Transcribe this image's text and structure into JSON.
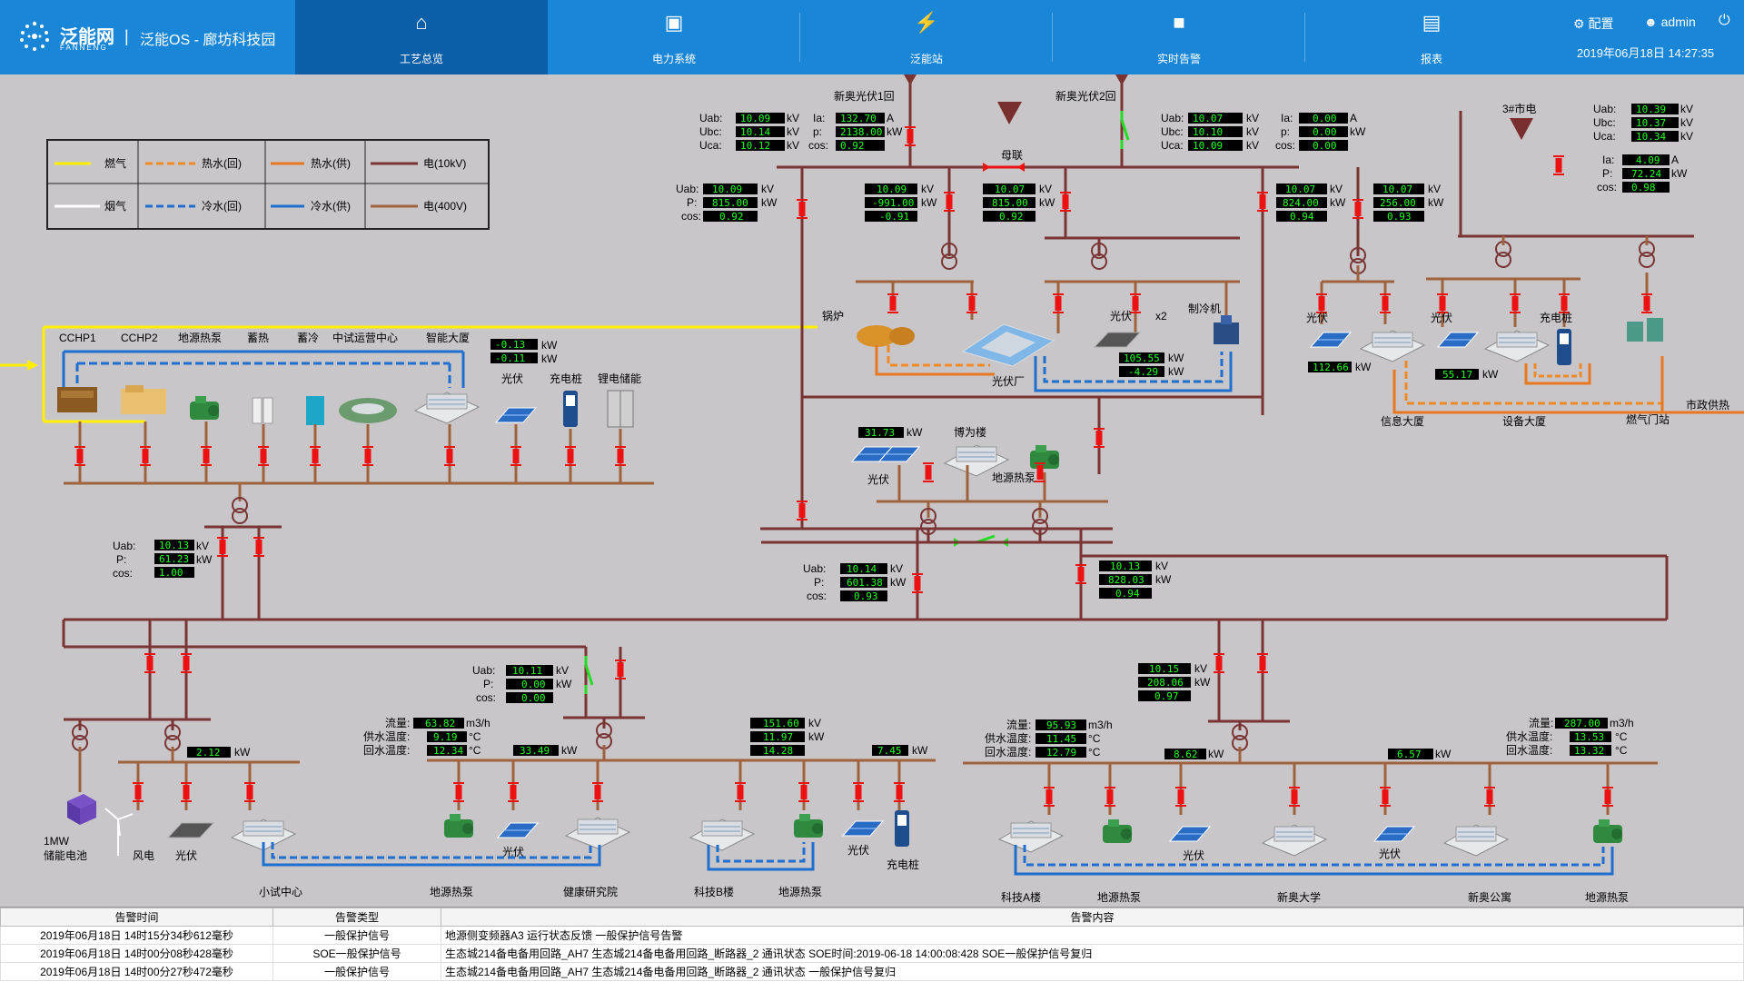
{
  "header": {
    "logo_cn": "泛能网",
    "logo_en": "FANNENG",
    "separator": "|",
    "system_title": "泛能OS - 廊坊科技园",
    "nav": [
      {
        "label": "工艺总览",
        "icon": "home-icon",
        "active": true
      },
      {
        "label": "电力系统",
        "icon": "monitor-icon",
        "active": false
      },
      {
        "label": "泛能站",
        "icon": "station-icon",
        "active": false
      },
      {
        "label": "实时告警",
        "icon": "alarm-icon",
        "active": false
      },
      {
        "label": "报表",
        "icon": "report-icon",
        "active": false
      }
    ],
    "config_label": "配置",
    "user_label": "admin",
    "datetime": "2019年06月18日 14:27:35"
  },
  "legend": {
    "items": [
      "燃气",
      "热水(回)",
      "热水(供)",
      "电(10kV)",
      "烟气",
      "冷水(回)",
      "冷水(供)",
      "电(400V)"
    ]
  },
  "labels": {
    "xinao_pv1": "新奥光伏1回",
    "xinao_pv2": "新奥光伏2回",
    "muliang": "母联",
    "city3": "3#市电",
    "boiler": "锅炉",
    "pv_plant": "光伏厂",
    "pv": "光伏",
    "x2": "x2",
    "chiller": "制冷机",
    "xinxi": "信息大厦",
    "shebei": "设备大厦",
    "charger": "充电桩",
    "shizheng": "市政供热",
    "ranqi_station": "燃气门站",
    "cchp1": "CCHP1",
    "cchp2": "CCHP2",
    "dyrb": "地源热泵",
    "xure": "蓄热",
    "xuleng": "蓄冷",
    "zszx": "中试运营中心",
    "znds": "智能大厦",
    "libat": "锂电储能",
    "bowei": "博为楼",
    "battery": "1MW",
    "battery2": "储能电池",
    "wind": "风电",
    "xszx": "小试中心",
    "jkyjy": "健康研究院",
    "kjb": "科技B楼",
    "kja": "科技A楼",
    "xadx": "新奥大学",
    "xagy": "新奥公寓",
    "liuliang": "流量:",
    "gongshui": "供水温度:",
    "huishui": "回水温度:"
  },
  "meters": {
    "a_uab": "10.09",
    "a_ubc": "10.14",
    "a_uca": "10.12",
    "b_ia": "132.70",
    "b_p": "2138.00",
    "b_cos": "0.92",
    "c_uab": "10.07",
    "c_ubc": "10.10",
    "c_uca": "10.09",
    "d_ia": "0.00",
    "d_p": "0.00",
    "d_cos": "0.00",
    "e_uab": "10.39",
    "e_ubc": "10.37",
    "e_uca": "10.34",
    "e_ia": "4.09",
    "e_p": "72.24",
    "e_cos": "0.98",
    "f_uab": "10.09",
    "f_p": "815.00",
    "f_cos": "0.92",
    "g1": "10.09",
    "g2": "-991.00",
    "g3": "-0.91",
    "h1": "10.07",
    "h2": "815.00",
    "h3": "0.92",
    "i1": "10.07",
    "i2": "824.00",
    "i3": "0.94",
    "j1": "10.07",
    "j2": "256.00",
    "j3": "0.93",
    "k1": "105.55",
    "k2": "-4.29",
    "l1": "112.66",
    "m1": "55.17",
    "n1": "-0.13",
    "n2": "-0.11",
    "o1": "31.73",
    "p_uab": "10.13",
    "p_p": "61.23",
    "p_cos": "1.00",
    "q_uab": "10.14",
    "q_p": "601.38",
    "q_cos": "0.93",
    "r1": "10.13",
    "r2": "828.03",
    "r3": "0.94",
    "s_uab": "10.11",
    "s_p": "0.00",
    "s_cos": "0.00",
    "t1": "10.15",
    "t2": "208.06",
    "t3": "0.97",
    "u1": "2.12",
    "v_flow": "63.82",
    "v_sup": "9.19",
    "v_ret": "12.34",
    "v_kw": "33.49",
    "w1": "151.60",
    "w2": "11.97",
    "w3": "14.28",
    "w4": "7.45",
    "x_flow": "95.93",
    "x_sup": "11.45",
    "x_ret": "12.79",
    "x_kw": "8.62",
    "y_kw": "6.57",
    "y_flow": "287.00",
    "y_sup": "13.53",
    "y_ret": "13.32"
  },
  "alarm_table": {
    "headers": [
      "告警时间",
      "告警类型",
      "告警内容"
    ],
    "rows": [
      [
        "2019年06月18日 14时15分34秒612毫秒",
        "一般保护信号",
        "地源侧变频器A3 运行状态反馈  一般保护信号告警"
      ],
      [
        "2019年06月18日 14时00分08秒428毫秒",
        "SOE一般保护信号",
        "生态城214备电备用回路_AH7 生态城214备电备用回路_断路器_2 通讯状态  SOE时间:2019-06-18 14:00:08:428 SOE一般保护信号复归"
      ],
      [
        "2019年06月18日 14时00分27秒472毫秒",
        "一般保护信号",
        "生态城214备电备用回路_AH7 生态城214备电备用回路_断路器_2 通讯状态  一般保护信号复归"
      ]
    ]
  },
  "colors": {
    "gas": "#ffee00",
    "hot_return": "#f08a24",
    "hot_supply": "#e87820",
    "elec_10kv": "#7a3434",
    "flue": "#ffffff",
    "cold_return": "#1f6fd0",
    "cold_supply": "#1f6fd0",
    "elec_400v": "#a0623c",
    "breaker": "#ee1111",
    "switch_open": "#22dd22"
  }
}
